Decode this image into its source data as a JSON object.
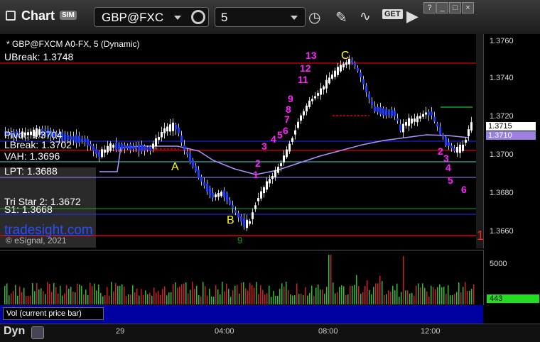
{
  "toolbar": {
    "app_title": "Chart",
    "sim_badge": "SIM",
    "symbol": "GBP@FXC",
    "interval": "5",
    "get_label": "GET"
  },
  "chart": {
    "header": "* GBP@FXCM A0-FX, 5 (Dynamic)",
    "levels": {
      "ubreak": "UBreak: 1.3748",
      "pivot": "Pivot: 1.3704",
      "lbreak": "LBreak: 1.3702",
      "vah": "VAH: 1.3696",
      "lpt": "LPT: 1.3688",
      "tristar": "Tri Star 2: 1.3672",
      "s1": "S1: 1.3668"
    },
    "watermark": "tradesight.com",
    "copyright": "© eSignal, 2021",
    "point_a": "A",
    "point_b": "B",
    "point_c": "C",
    "price_axis": [
      "1.3760",
      "1.3740",
      "1.3720",
      "1.3700",
      "1.3680",
      "1.3660"
    ],
    "last_price": "1.3715",
    "ma_price": "1.3710",
    "setup_counts_left": [
      "1",
      "2",
      "3",
      "4",
      "5",
      "6",
      "7",
      "8",
      "9",
      "11",
      "12",
      "13"
    ],
    "setup_counts_right": [
      "2",
      "3",
      "4",
      "5",
      "6"
    ],
    "red_one": "1",
    "green_nine": "9"
  },
  "volume": {
    "label": "Vol (current price bar)",
    "axis_top": "5000",
    "current": "443"
  },
  "time_axis": [
    "29",
    "04:00",
    "08:00",
    "12:00"
  ],
  "footer": {
    "dyn": "Dyn"
  },
  "colors": {
    "up_candle": "#ffffff",
    "down_candle": "#1a3cff",
    "levels_red": "#e00000",
    "magenta": "#ff20ff",
    "green_count": "#18a018",
    "ma_line": "#b090ff",
    "vol_up": "#2fbf2f",
    "vol_down": "#d02020"
  }
}
